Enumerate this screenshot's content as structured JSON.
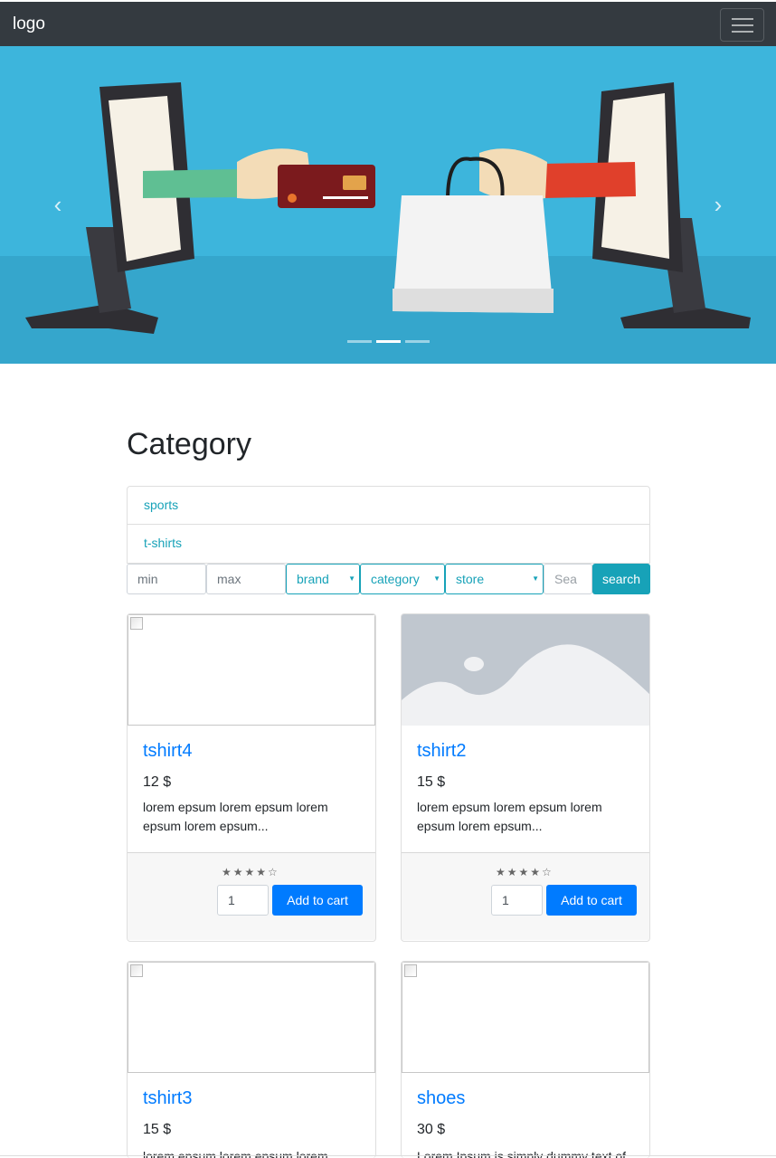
{
  "navbar": {
    "logo": "logo",
    "menu_icon": "hamburger-icon"
  },
  "carousel": {
    "prev_icon": "chevron-left-icon",
    "next_icon": "chevron-right-icon",
    "prev_glyph": "‹",
    "next_glyph": "›",
    "active_slide_index": 1,
    "slide_count": 3,
    "colors": {
      "sky": "#3db5dc",
      "floor": "#35a6cc"
    }
  },
  "main": {
    "title": "Category",
    "categories": [
      {
        "label": "sports"
      },
      {
        "label": "t-shirts"
      }
    ],
    "filters": {
      "min_placeholder": "min",
      "max_placeholder": "max",
      "brand": "brand",
      "category": "category",
      "store": "store",
      "search_placeholder": "Sea",
      "search_button": "search"
    },
    "products": [
      {
        "title": "tshirt4",
        "price": "12 $",
        "description": "lorem epsum lorem epsum lorem epsum lorem epsum...",
        "rating_text": "★★★★☆",
        "rating": 4,
        "qty": "1",
        "cart_label": "Add to cart"
      },
      {
        "title": "tshirt2",
        "price": "15 $",
        "description": "lorem epsum lorem epsum lorem epsum lorem epsum...",
        "rating_text": "★★★★☆",
        "rating": 4,
        "qty": "1",
        "cart_label": "Add to cart"
      },
      {
        "title": "tshirt3",
        "price": "15 $",
        "description": "lorem epsum lorem epsum lorem"
      },
      {
        "title": "shoes",
        "price": "30 $",
        "description": "Lorem Ipsum is simply dummy text of"
      }
    ]
  },
  "colors": {
    "navbar": "#343a40",
    "primary": "#007bff",
    "info": "#17a2b8"
  }
}
